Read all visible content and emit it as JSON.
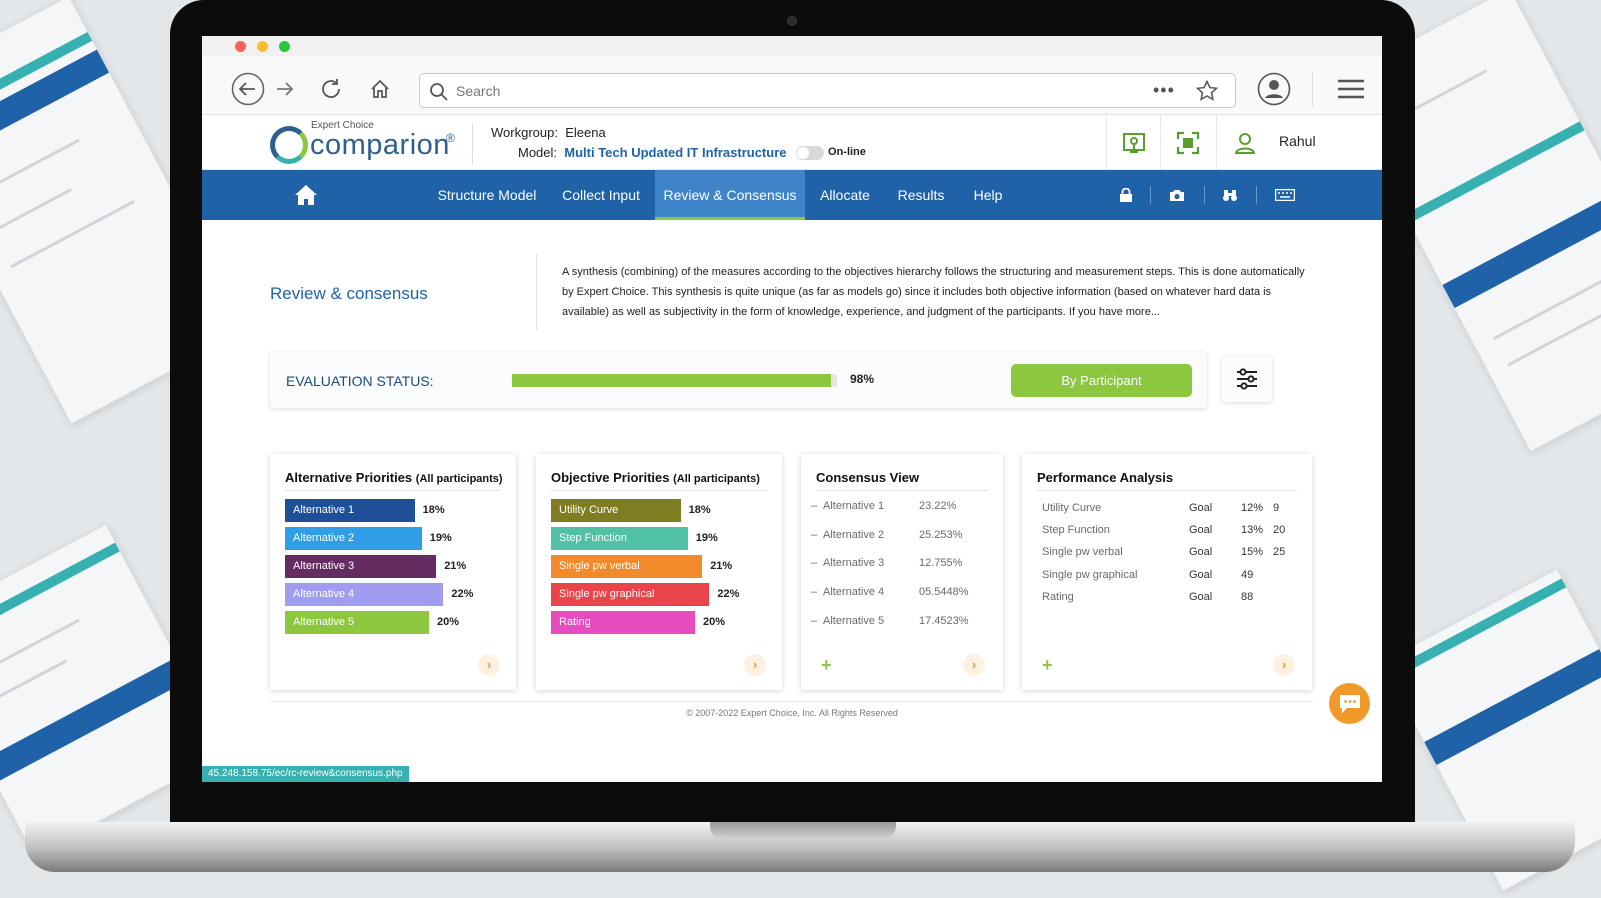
{
  "browser": {
    "search_placeholder": "Search",
    "more_icon": "ellipsis-icon",
    "status_url": "45.248.158.75/ec/rc-review&consensus.php"
  },
  "app": {
    "logo_small": "Expert Choice",
    "logo_main": "comparion",
    "logo_reg": "®",
    "workgroup_label": "Workgroup:",
    "workgroup_value": "Eleena",
    "model_label": "Model:",
    "model_value": "Multi Tech Updated IT Infrastructure",
    "online_label": "On-line",
    "user_name": "Rahul"
  },
  "nav": {
    "items": [
      {
        "label": "Structure Model"
      },
      {
        "label": "Collect Input"
      },
      {
        "label": "Review & Consensus"
      },
      {
        "label": "Allocate"
      },
      {
        "label": "Results"
      },
      {
        "label": "Help"
      }
    ],
    "active": "Review & Consensus"
  },
  "page": {
    "title": "Review & consensus",
    "description": "A synthesis (combining) of the measures according to the objectives hierarchy follows the structuring and measurement steps. This is done automatically by Expert Choice. This synthesis is quite unique (as far as models go) since it includes both objective information (based on whatever hard data is available) as well as subjectivity in the form of knowledge, experience, and judgment of the participants. If you have more..."
  },
  "evaluation": {
    "label": "EVALUATION STATUS:",
    "progress": 0.98,
    "percent_text": "98%",
    "button_label": "By Participant"
  },
  "cards": {
    "alternative": {
      "title": "Alternative Priorities",
      "subtitle": "(All participants)",
      "items": [
        {
          "label": "Alternative 1",
          "value": "18%",
          "pct": 18,
          "color": "#1f4f96"
        },
        {
          "label": "Alternative 2",
          "value": "19%",
          "pct": 19,
          "color": "#2f9ee6"
        },
        {
          "label": "Alternative 3",
          "value": "21%",
          "pct": 21,
          "color": "#642c61"
        },
        {
          "label": "Alternative 4",
          "value": "22%",
          "pct": 22,
          "color": "#a09cf0"
        },
        {
          "label": "Alternative 5",
          "value": "20%",
          "pct": 20,
          "color": "#8dc63f"
        }
      ]
    },
    "objective": {
      "title": "Objective Priorities",
      "subtitle": "(All participants)",
      "items": [
        {
          "label": "Utility Curve",
          "value": "18%",
          "pct": 18,
          "color": "#7e7d22"
        },
        {
          "label": "Step Function",
          "value": "19%",
          "pct": 19,
          "color": "#50c1a4"
        },
        {
          "label": "Single pw verbal",
          "value": "21%",
          "pct": 21,
          "color": "#f08a2b"
        },
        {
          "label": "Single pw graphical",
          "value": "22%",
          "pct": 22,
          "color": "#e84449"
        },
        {
          "label": "Rating",
          "value": "20%",
          "pct": 20,
          "color": "#e84bbe"
        }
      ]
    },
    "consensus": {
      "title": "Consensus View",
      "items": [
        {
          "label": "Alternative 1",
          "value": "23.22%"
        },
        {
          "label": "Alternative 2",
          "value": "25.253%"
        },
        {
          "label": "Alternative 3",
          "value": "12.755%"
        },
        {
          "label": "Alternative 4",
          "value": "05.5448%"
        },
        {
          "label": "Alternative 5",
          "value": "17.4523%"
        }
      ]
    },
    "performance": {
      "title": "Performance Analysis",
      "rows": [
        {
          "name": "Utility Curve",
          "type": "Goal",
          "pct": "12%",
          "num": "9"
        },
        {
          "name": "Step Function",
          "type": "Goal",
          "pct": "13%",
          "num": "20"
        },
        {
          "name": "Single pw verbal",
          "type": "Goal",
          "pct": "15%",
          "num": "25"
        },
        {
          "name": "Single pw graphical",
          "type": "Goal",
          "pct": "49",
          "num": ""
        },
        {
          "name": "Rating",
          "type": "Goal",
          "pct": "88",
          "num": ""
        }
      ]
    }
  },
  "footer": {
    "copyright": "© 2007-2022 Expert Choice, Inc. All Rights Reserved"
  },
  "colors": {
    "nav_blue": "#1f62a8",
    "accent_green": "#8dc63f",
    "teal": "#37b0b1",
    "orange": "#f09a2a"
  }
}
